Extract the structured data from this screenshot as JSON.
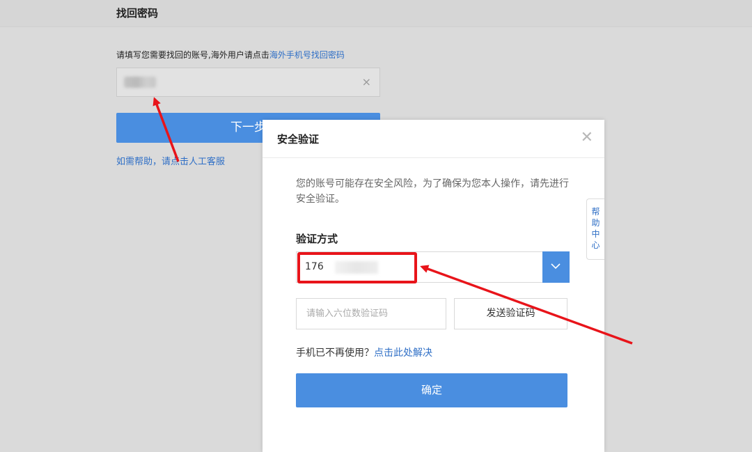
{
  "page": {
    "title": "找回密码",
    "instruction_prefix": "请填写您需要找回的账号,海外用户请点击",
    "instruction_link": "海外手机号找回密码",
    "next_button": "下一步",
    "help_prefix": "如需帮助，",
    "help_link": "请点击人工客服"
  },
  "modal": {
    "title": "安全验证",
    "message": "您的账号可能存在安全风险，为了确保为您本人操作，请先进行安全验证。",
    "method_label": "验证方式",
    "method_value": "176",
    "code_placeholder": "请输入六位数验证码",
    "send_code_button": "发送验证码",
    "phone_issue_prefix": "手机已不再使用？",
    "phone_issue_link": "点击此处解决",
    "confirm_button": "确定"
  },
  "help_center": {
    "chars": [
      "帮",
      "助",
      "中",
      "心"
    ]
  },
  "icons": {
    "close": "close-icon",
    "clear": "clear-icon",
    "dropdown": "chevron-down-icon"
  },
  "colors": {
    "accent": "#4a8ee0",
    "link": "#2f6fc6",
    "annotation": "#e8141a"
  }
}
